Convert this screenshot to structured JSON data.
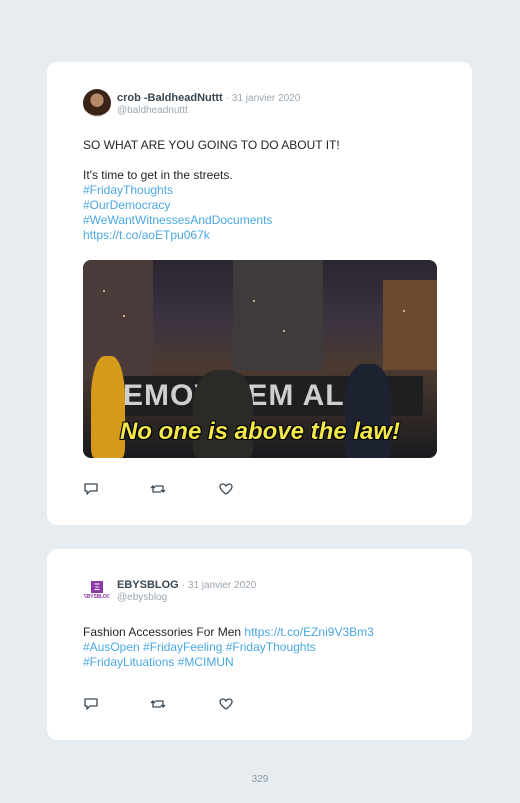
{
  "tweets": [
    {
      "name": "crob -BaldheadNuttt",
      "date": "· 31 janvier 2020",
      "handle": "@baldheadnuttt",
      "lines": [
        {
          "text": "SO WHAT ARE YOU GOING TO DO ABOUT IT!",
          "link": false
        },
        {
          "text": "It's time to get in the streets.",
          "link": false
        },
        {
          "text": "#FridayThoughts",
          "link": true
        },
        {
          "text": "#OurDemocracy",
          "link": true
        },
        {
          "text": "#WeWantWitnessesAndDocuments",
          "link": true
        },
        {
          "text": "https://t.co/aoETpu067k",
          "link": true
        }
      ],
      "media": {
        "banner_text": "EMOV HEM AL",
        "caption": "No one is above the law!"
      },
      "actions": [
        "reply-icon",
        "retweet-icon",
        "like-icon"
      ]
    },
    {
      "name": "EBYSBLOG",
      "date": "· 31 janvier 2020",
      "handle": "@ebysblog",
      "avatar_text": "EBYSBLOG",
      "lines": [
        {
          "text": "Fashion Accessories For Men ",
          "link": false
        },
        {
          "text": "https://t.co/EZni9V3Bm3",
          "link": true
        },
        {
          "text": "#AusOpen #FridayFeeling #FridayThoughts",
          "link": true
        },
        {
          "text": "#FridayLituations #MCIMUN",
          "link": true
        }
      ],
      "actions": [
        "reply-icon",
        "retweet-icon",
        "like-icon"
      ]
    }
  ],
  "page_number": "329",
  "colors": {
    "link": "#4aa7e3",
    "background": "#e6ecf0",
    "caption": "#f3e84a"
  }
}
